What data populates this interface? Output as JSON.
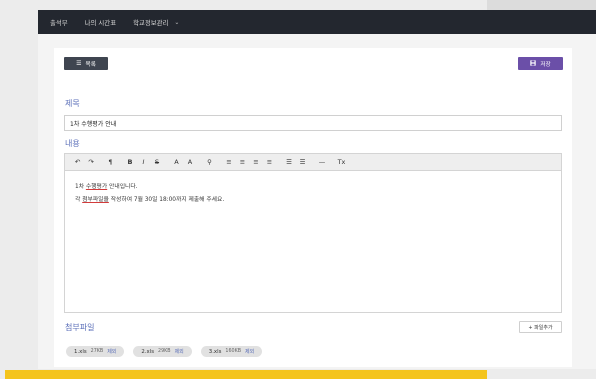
{
  "nav": {
    "items": [
      "출석부",
      "나의 시간표",
      "학교정보관리"
    ],
    "caret": "⌄"
  },
  "toolbar_buttons": {
    "list_label": "목록",
    "save_label": "저장"
  },
  "form": {
    "title_label": "제목",
    "title_value": "1차 수행평가 안내",
    "content_label": "내용",
    "attach_label": "첨부파일",
    "add_file_label": "+ 파일추가"
  },
  "editor": {
    "tools": [
      "↶",
      "↷",
      "¶",
      "B",
      "I",
      "S",
      "A",
      "A",
      "⚲",
      "≡",
      "≡",
      "≡",
      "≡",
      "☰",
      "☰",
      "—",
      "Tx"
    ],
    "line1_prefix": "1차 ",
    "line1_underlined": "수행평가",
    "line1_suffix": " 안내입니다.",
    "line2_prefix": "각 ",
    "line2_underlined": "첨부파일을",
    "line2_suffix": " 작성하여 7월 30일 18:00까지 제출해 주세요."
  },
  "files": [
    {
      "name": "1.xls",
      "size": "27KB",
      "delete": "제외"
    },
    {
      "name": "2.xls",
      "size": "29KB",
      "delete": "제외"
    },
    {
      "name": "3.xls",
      "size": "160KB",
      "delete": "제외"
    }
  ],
  "colors": {
    "topbar": "#23272f",
    "accent_label": "#5a6eb8",
    "save_button": "#6b4fa8",
    "list_button": "#3f4550",
    "bottom_bar": "#f4c41c"
  }
}
